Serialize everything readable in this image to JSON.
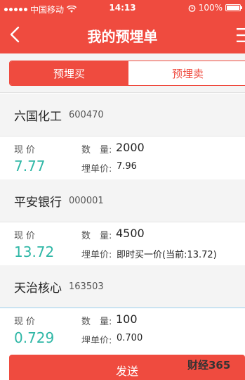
{
  "status_bar": {
    "carrier": "中国移动",
    "time": "14:13",
    "battery": "100%",
    "battery_level": 1.0
  },
  "nav": {
    "title": "我的预埋单"
  },
  "tabs": [
    {
      "label": "预埋买",
      "active": true
    },
    {
      "label": "预埋卖",
      "active": false
    }
  ],
  "labels": {
    "price": "现价",
    "qty": "数　量:",
    "order_price": "埋单价:"
  },
  "stocks": [
    {
      "name": "六国化工",
      "code": "600470",
      "price": "7.77",
      "qty": "2000",
      "order_price": "7.96"
    },
    {
      "name": "平安银行",
      "code": "000001",
      "price": "13.72",
      "qty": "4500",
      "order_price": "即时买一价(当前:13.72)"
    },
    {
      "name": "天治核心",
      "code": "163503",
      "price": "0.729",
      "qty": "100",
      "order_price": "0.700"
    }
  ],
  "actions": {
    "send_label": "发送"
  },
  "watermark": {
    "text": "财经365"
  },
  "colors": {
    "accent": "#ef4b3f",
    "price": "#2fb7a6"
  }
}
